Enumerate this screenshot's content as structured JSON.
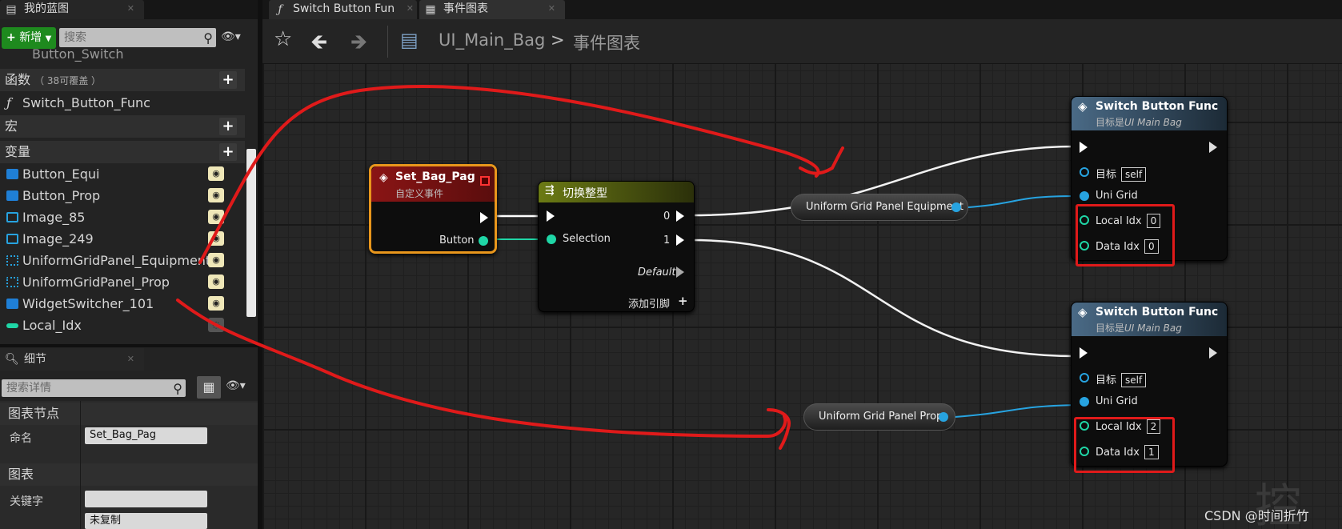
{
  "left_tabs": {
    "blueprint": "我的蓝图",
    "details": "细节"
  },
  "graph_tabs": [
    {
      "label": "Switch Button Fun",
      "icon": "function-icon"
    },
    {
      "label": "事件图表",
      "icon": "graph-icon"
    }
  ],
  "toolbar": {
    "new_label": "新增",
    "search_placeholder": "搜索"
  },
  "tree": {
    "cut_item": "Button_Switch",
    "functions_label": "函数",
    "functions_note": "（ 38可覆盖 ）",
    "function_item": "Switch_Button_Func",
    "macros_label": "宏",
    "variables_label": "变量",
    "variables": [
      "Button_Equi",
      "Button_Prop",
      "Image_85",
      "Image_249",
      "UniformGridPanel_Equipment",
      "UniformGridPanel_Prop",
      "WidgetSwitcher_101",
      "Local_Idx"
    ]
  },
  "details": {
    "search_placeholder": "搜索详情",
    "graph_node_section": "图表节点",
    "name_label": "命名",
    "name_value": "Set_Bag_Pag",
    "graph_section": "图表",
    "keyword_label": "关键字",
    "dropdown_value": "未复制"
  },
  "breadcrumb": {
    "blueprint": "UI_Main_Bag",
    "separator": ">",
    "graph": "事件图表"
  },
  "nodes": {
    "event": {
      "title": "Set_Bag_Pag",
      "subtitle": "自定义事件",
      "pin_button": "Button"
    },
    "switch": {
      "title": "切换整型",
      "pin_selection": "Selection",
      "out0": "0",
      "out1": "1",
      "default": "Default",
      "add_pin": "添加引脚"
    },
    "var_equipment": "Uniform Grid Panel Equipment",
    "var_prop": "Uniform Grid Panel Prop",
    "func1": {
      "title": "Switch Button Func",
      "subtitle": "目标是",
      "subtitle_em": "UI Main Bag",
      "target_label": "目标",
      "target_value": "self",
      "unigrid": "Uni Grid",
      "local_label": "Local Idx",
      "local_value": "0",
      "data_label": "Data Idx",
      "data_value": "0"
    },
    "func2": {
      "title": "Switch Button Func",
      "subtitle": "目标是",
      "subtitle_em": "UI Main Bag",
      "target_label": "目标",
      "target_value": "self",
      "unigrid": "Uni Grid",
      "local_label": "Local Idx",
      "local_value": "2",
      "data_label": "Data Idx",
      "data_value": "1"
    }
  },
  "watermark": "CSDN @时间折竹",
  "bg_text": "控件",
  "colors": {
    "event_header": "#8a1515",
    "switch_header": "#5d6a12",
    "func_header": "#3b5a72",
    "exec": "#ffffff",
    "object_pin": "#27a3e0",
    "int_pin": "#1fd6a6",
    "annotation": "#e01a1a",
    "new_button": "#1e8a1e"
  }
}
